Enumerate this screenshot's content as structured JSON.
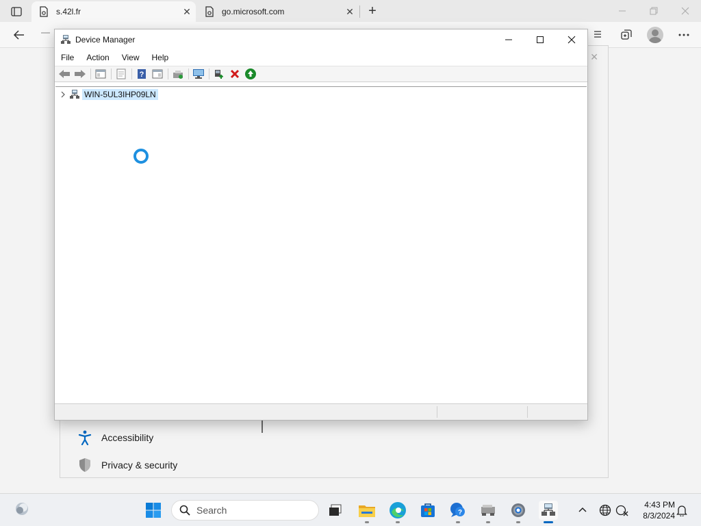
{
  "browser": {
    "tabs": [
      {
        "title": "s.42l.fr",
        "active": true
      },
      {
        "title": "go.microsoft.com",
        "active": false
      }
    ],
    "close_glyph": "✕",
    "new_tab_glyph": "+"
  },
  "settings_background": {
    "items": [
      {
        "label": "Accessibility",
        "icon": "accessibility-icon"
      },
      {
        "label": "Privacy & security",
        "icon": "shield-icon"
      }
    ]
  },
  "device_manager": {
    "title": "Device Manager",
    "menu": [
      "File",
      "Action",
      "View",
      "Help"
    ],
    "tree": {
      "root_label": "WIN-5UL3IHP09LN",
      "expanded": false
    },
    "toolbar_icons": [
      "back-icon",
      "forward-icon",
      "show-hide-console-tree-icon",
      "properties-icon",
      "help-icon",
      "action-pane-icon",
      "update-driver-icon",
      "scan-hardware-icon",
      "enable-device-icon",
      "uninstall-device-icon",
      "update-green-icon"
    ],
    "colors": {
      "selection": "#cce8ff",
      "spinner": "#1e90e0",
      "uninstall_red": "#d11a1a",
      "enable_green": "#1a8a2a"
    }
  },
  "taskbar": {
    "search_placeholder": "Search",
    "time": "4:43 PM",
    "date": "8/3/2024",
    "apps": [
      "task-view",
      "file-explorer",
      "edge",
      "microsoft-store",
      "get-help",
      "network-drive",
      "settings",
      "device-manager"
    ],
    "accent": "#0067c0"
  }
}
